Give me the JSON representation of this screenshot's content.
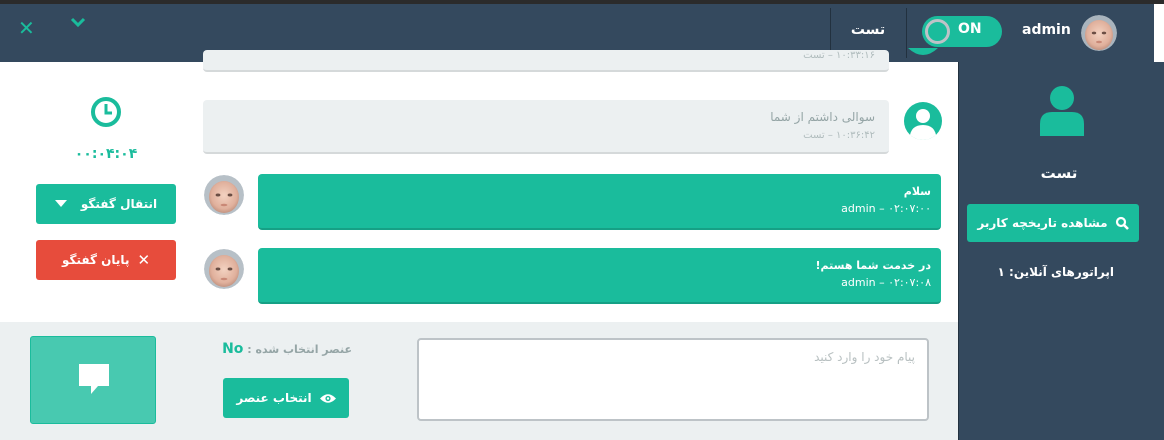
{
  "header": {
    "visitor_name": "تست",
    "toggle_label": "ON",
    "username": "admin"
  },
  "sidebar": {
    "visitor_name": "تست",
    "history_button": "مشاهده تاریخچه کاربر",
    "online_operators": "اپراتورهای آنلاین: ۱"
  },
  "controls": {
    "timer": "۰۰:۰۴:۰۴",
    "transfer_button": "انتقال گفتگو",
    "end_button": "پایان گفتگو"
  },
  "messages": [
    {
      "text": "",
      "meta": "۱۰:۳۳:۱۶ – تست"
    },
    {
      "text": "سوالی داشتم از شما",
      "meta": "۱۰:۳۶:۴۲ – تست"
    },
    {
      "text": "سلام",
      "meta": "admin – ۰۲:۰۷:۰۰"
    },
    {
      "text": "در خدمت شما هستم!",
      "meta": "admin – ۰۲:۰۷:۰۸"
    }
  ],
  "composer": {
    "placeholder": "پیام خود را وارد کنید",
    "selected_label": "عنصر انتخاب شده :",
    "selected_value": "No",
    "select_button": "انتخاب عنصر"
  },
  "colors": {
    "accent": "#1abc9c",
    "header_bg": "#34495e",
    "danger": "#e74c3c",
    "bubble_in": "#ecf0f1"
  }
}
